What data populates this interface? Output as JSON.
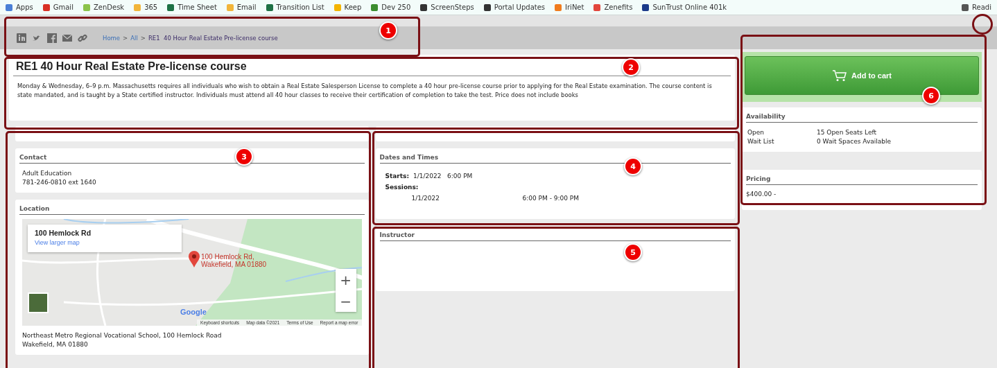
{
  "bookmarks": [
    {
      "label": "Apps",
      "color": "#4a7fd6"
    },
    {
      "label": "Gmail",
      "color": "#d93025"
    },
    {
      "label": "ZenDesk",
      "color": "#8bc34a"
    },
    {
      "label": "365",
      "color": "#f2b53a"
    },
    {
      "label": "Time Sheet",
      "color": "#1e7145"
    },
    {
      "label": "Email",
      "color": "#f2b53a"
    },
    {
      "label": "Transition List",
      "color": "#1e7145"
    },
    {
      "label": "Keep",
      "color": "#f4b400"
    },
    {
      "label": "Dev 250",
      "color": "#3c8d2f"
    },
    {
      "label": "ScreenSteps",
      "color": "#333333"
    },
    {
      "label": "Portal Updates",
      "color": "#333333"
    },
    {
      "label": "IriNet",
      "color": "#f07c1e"
    },
    {
      "label": "Zenefits",
      "color": "#e2463c"
    },
    {
      "label": "SunTrust Online 401k",
      "color": "#1b3a8a"
    },
    {
      "label": "Readi",
      "color": "#555555"
    }
  ],
  "breadcrumb": [
    {
      "label": "Home",
      "kind": "link"
    },
    {
      "label": ">",
      "kind": "sep"
    },
    {
      "label": "All",
      "kind": "link"
    },
    {
      "label": ">",
      "kind": "sep"
    },
    {
      "label": "RE1  40 Hour Real Estate Pre-license course",
      "kind": "current"
    }
  ],
  "course": {
    "title": "RE1  40 Hour Real Estate Pre-license course",
    "description": "Monday & Wednesday, 6–9 p.m. Massachusetts requires all individuals who wish to obtain a Real Estate Salesperson License to complete a 40 hour pre-license course prior to applying for the Real Estate examination. The course content is state mandated, and is taught by a State certified instructor. Individuals must attend all 40 hour classes to receive their certification of completion to take the test. Price does not include books"
  },
  "contact": {
    "heading": "Contact",
    "lines": [
      "Adult Education",
      "781-246-0810 ext 1640"
    ]
  },
  "location": {
    "heading": "Location",
    "map": {
      "place": "100 Hemlock Rd",
      "link": "View larger map",
      "marker_label": "100 Hemlock Rd, Wakefield, MA 01880",
      "zoom_in": "+",
      "zoom_out": "−",
      "logo": "Google",
      "footer": [
        "Keyboard shortcuts",
        "Map data ©2021",
        "Terms of Use",
        "Report a map error"
      ]
    },
    "address": [
      "Northeast Metro Regional Vocational School, 100 Hemlock Road",
      "Wakefield, MA 01880"
    ]
  },
  "dates": {
    "heading": "Dates and Times",
    "starts_label": "Starts:",
    "starts_value": "1/1/2022   6:00 PM",
    "sessions_label": "Sessions:",
    "sessions": [
      {
        "date": "1/1/2022",
        "time": "6:00 PM - 9:00 PM"
      }
    ]
  },
  "instructor": {
    "heading": "Instructor"
  },
  "cart": {
    "label": "Add to cart"
  },
  "availability": {
    "heading": "Availability",
    "rows": [
      {
        "name": "Open",
        "value": "15 Open Seats Left"
      },
      {
        "name": "Wait List",
        "value": "0 Wait Spaces Available"
      }
    ]
  },
  "pricing": {
    "heading": "Pricing",
    "price": "$400.00 -"
  },
  "annotations": [
    {
      "label": "1"
    },
    {
      "label": "2"
    },
    {
      "label": "3"
    },
    {
      "label": "4"
    },
    {
      "label": "5"
    },
    {
      "label": "6"
    }
  ]
}
